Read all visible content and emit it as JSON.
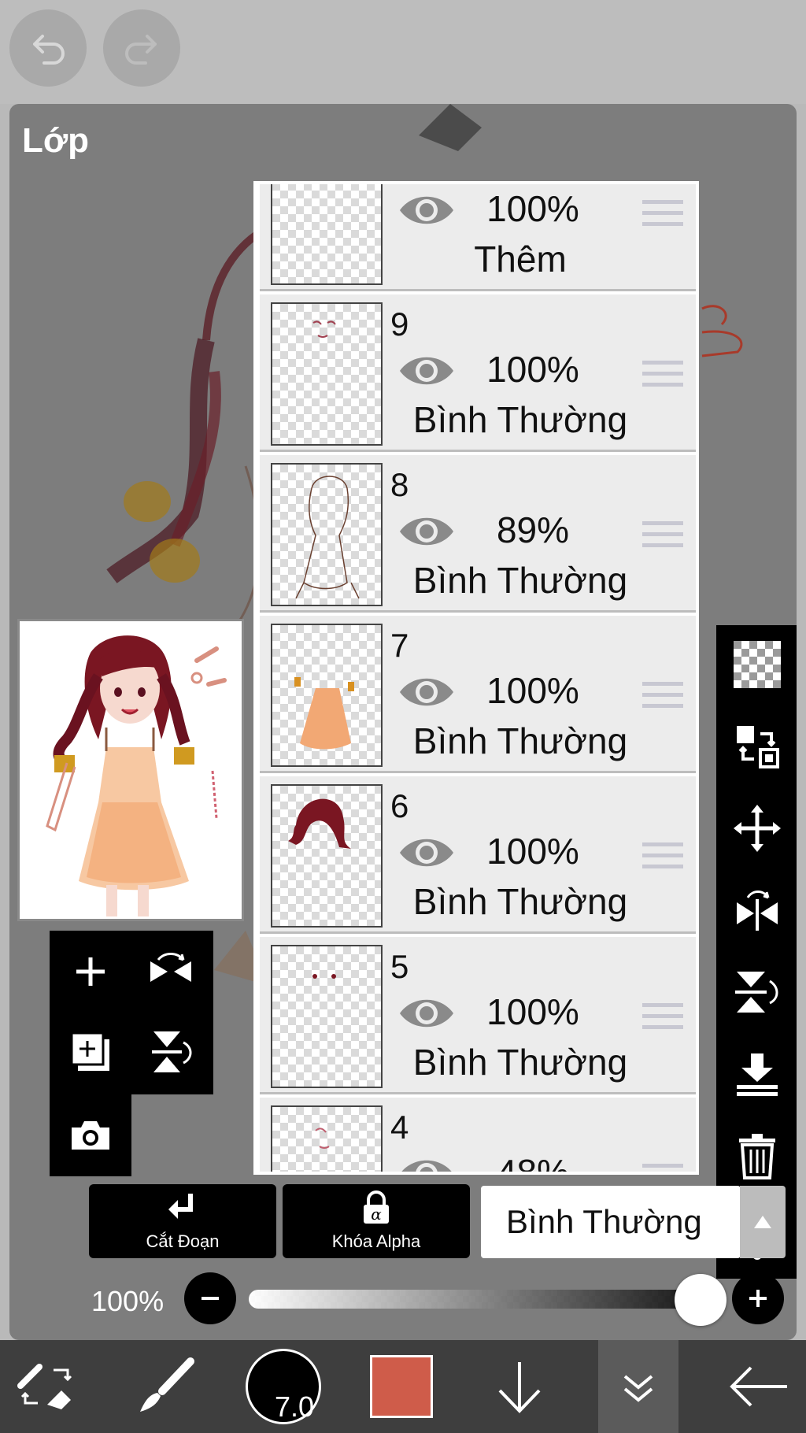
{
  "topbar": {
    "undo_icon": "undo-icon",
    "redo_icon": "redo-icon"
  },
  "panel": {
    "title": "Lớp"
  },
  "layers": [
    {
      "number": "",
      "opacity": "100%",
      "blend": "Thêm"
    },
    {
      "number": "9",
      "opacity": "100%",
      "blend": "Bình Thường"
    },
    {
      "number": "8",
      "opacity": "89%",
      "blend": "Bình Thường"
    },
    {
      "number": "7",
      "opacity": "100%",
      "blend": "Bình Thường"
    },
    {
      "number": "6",
      "opacity": "100%",
      "blend": "Bình Thường"
    },
    {
      "number": "5",
      "opacity": "100%",
      "blend": "Bình Thường"
    },
    {
      "number": "4",
      "opacity": "48%",
      "blend": ""
    }
  ],
  "controls": {
    "clip_label": "Cắt Đoạn",
    "alpha_label": "Khóa Alpha",
    "blend_mode": "Bình Thường",
    "opacity_value": "100%",
    "opacity_fraction": 1.0
  },
  "toolbar": {
    "brush_size": "7.0",
    "color": "#cf5c4a"
  }
}
